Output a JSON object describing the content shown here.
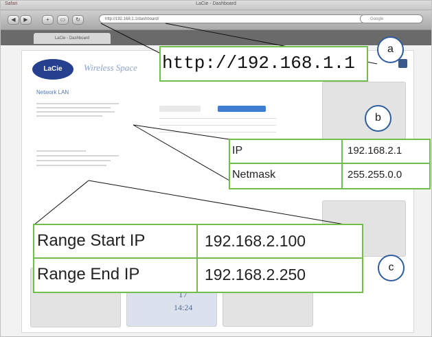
{
  "window": {
    "title": "LaCie - Dashboard",
    "app_name": "Safari"
  },
  "toolbar": {
    "url_text": "http://192.168.1.1/dashboard/",
    "search_placeholder": "Google"
  },
  "tabs": [
    {
      "label": "LaCie - Dashboard"
    }
  ],
  "page": {
    "logo_text": "LaCie",
    "app_title": "Wireless Space",
    "section_title": "Network LAN"
  },
  "callouts": {
    "a": {
      "letter": "a",
      "url": "http://192.168.1.1"
    },
    "b": {
      "letter": "b",
      "ip_label": "IP",
      "ip_value": "192.168.2.1",
      "netmask_label": "Netmask",
      "netmask_value": "255.255.0.0"
    },
    "c": {
      "letter": "c",
      "start_label": "Range Start IP",
      "start_value": "192.168.2.100",
      "end_label": "Range End IP",
      "end_value": "192.168.2.250"
    }
  },
  "widgets": {
    "clock_date": "17",
    "clock_time": "14:24"
  },
  "colors": {
    "callout_border": "#6fbf4a",
    "letter_ring": "#2e5d9e",
    "accent": "#25408f"
  }
}
